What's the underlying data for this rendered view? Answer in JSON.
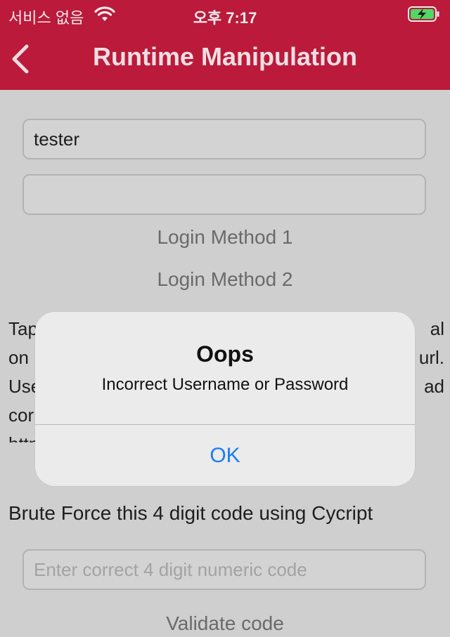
{
  "status": {
    "carrier": "서비스 없음",
    "time": "오후 7:17"
  },
  "navbar": {
    "title": "Runtime Manipulation"
  },
  "login": {
    "username_value": "tester",
    "password_value": "",
    "method1_label": "Login Method 1",
    "method2_label": "Login Method 2"
  },
  "description": {
    "lines": [
      "Tap",
      "on",
      "Use",
      "cor",
      "http"
    ],
    "right_fragments": [
      "al",
      "url.",
      "ad"
    ]
  },
  "brute": {
    "label": "Brute Force this 4 digit code using Cycript",
    "code_placeholder": "Enter correct 4 digit numeric code",
    "validate_label": "Validate code"
  },
  "alert": {
    "title": "Oops",
    "message": "Incorrect Username or Password",
    "ok_label": "OK"
  },
  "colors": {
    "nav_bg": "#bb1a3a",
    "page_bg": "#cfcfcf",
    "link_blue": "#1a7df3"
  }
}
